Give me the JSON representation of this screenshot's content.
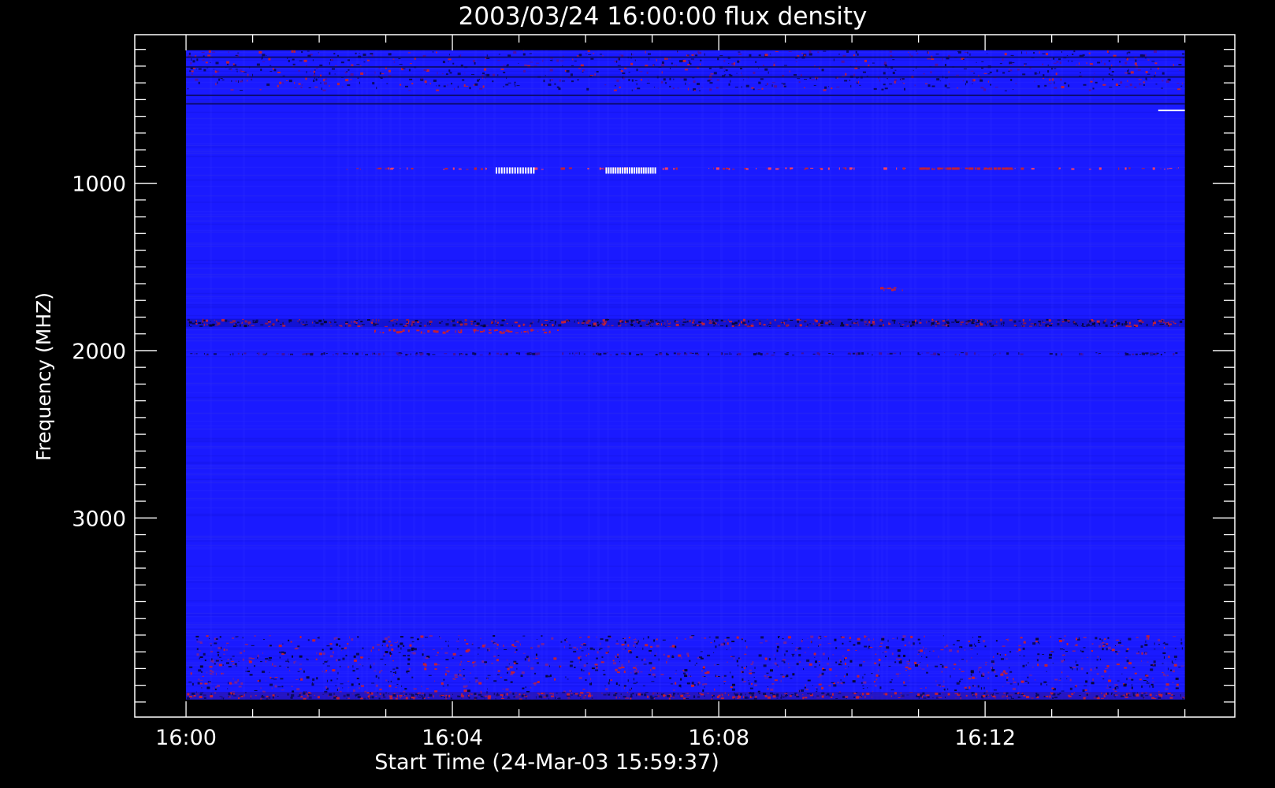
{
  "chart_data": {
    "type": "heatmap",
    "title": "2003/03/24 16:00:00 flux density",
    "xlabel": "Start Time (24-Mar-03 15:59:37)",
    "ylabel": "Frequency (MHZ)",
    "x_tick_labels": [
      "16:00",
      "16:04",
      "16:08",
      "16:12"
    ],
    "x_tick_minutes": [
      0,
      4,
      8,
      12
    ],
    "y_tick_labels": [
      "1000",
      "2000",
      "3000"
    ],
    "y_tick_values": [
      1000,
      2000,
      3000
    ],
    "y_axis_inverted": true,
    "xlim_minutes": [
      -0.77,
      15.75
    ],
    "ylim_mhz": [
      112,
      4190
    ],
    "data_extent": {
      "time_minutes": [
        0,
        15.0
      ],
      "frequency_mhz": [
        205,
        4085
      ]
    },
    "features": [
      {
        "name": "interference band",
        "frequency_mhz": 1830,
        "time_minutes": [
          0,
          15.0
        ],
        "intensity": "red/dark mixed"
      },
      {
        "name": "sporadic spikes",
        "frequency_mhz": 912,
        "time_minutes": [
          4.6,
          12.5
        ],
        "intensity": "red/white"
      },
      {
        "name": "narrow emission",
        "frequency_mhz": 560,
        "time_minutes": [
          14.6,
          15.0
        ],
        "intensity": "white"
      },
      {
        "name": "noisy low-frequency rows",
        "frequency_mhz": [
          205,
          450
        ],
        "intensity": "red/dark mixed"
      },
      {
        "name": "noisy high-frequency rows",
        "frequency_mhz": [
          3800,
          4085
        ],
        "intensity": "red/dark mixed"
      }
    ],
    "grid": false,
    "colors": {
      "background": "#000000",
      "axes": "#ffffff",
      "base": "#1a1aff",
      "dark": "#0a0a60",
      "hot": "#c0203a",
      "white": "#ffffff"
    }
  }
}
